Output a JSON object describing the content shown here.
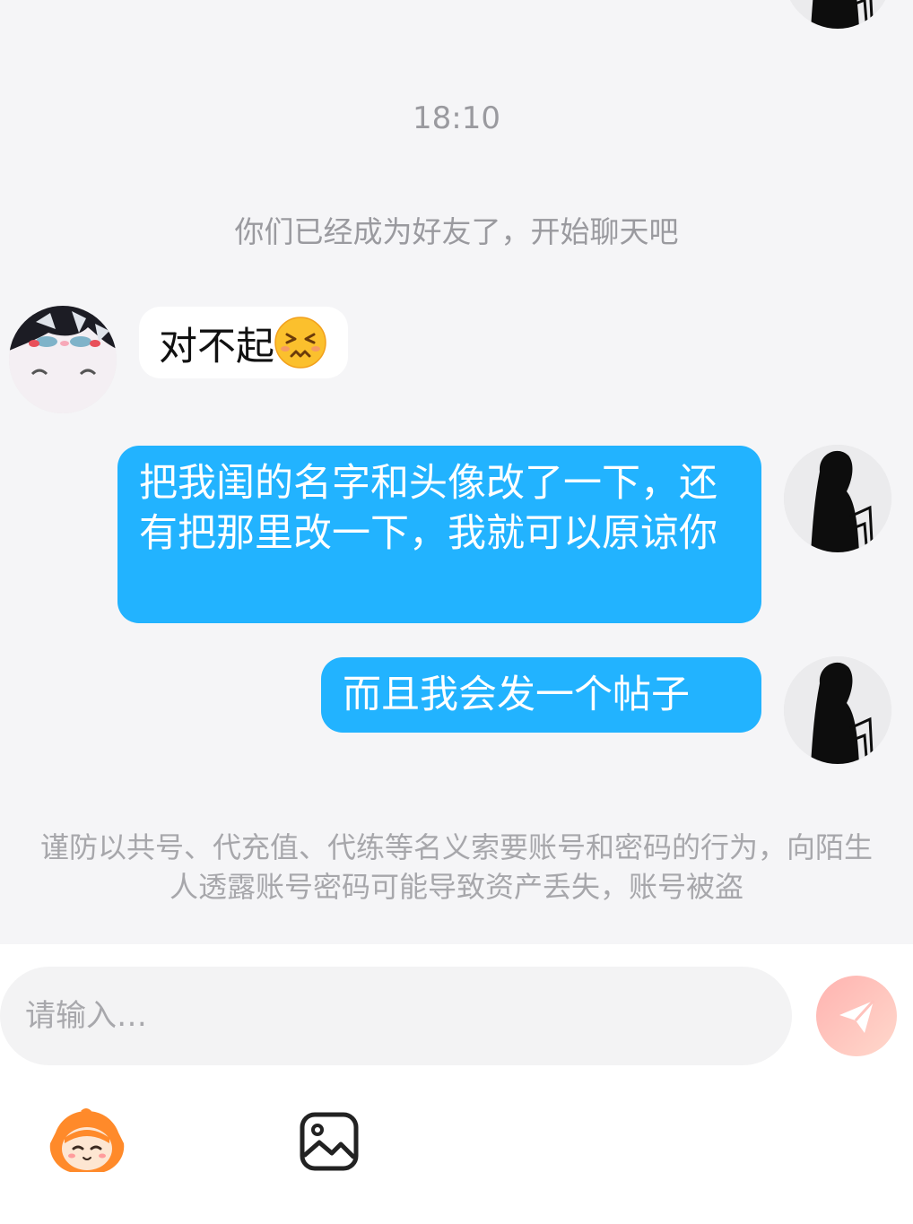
{
  "chat": {
    "timestamp": "18:10",
    "system_notice": "你们已经成为好友了，开始聊天吧",
    "messages": [
      {
        "side": "received",
        "text": "对不起",
        "emoji": "persevering-face"
      },
      {
        "side": "sent",
        "text": "把我闺的名字和头像改了一下，还有把那里改一下，我就可以原谅你"
      },
      {
        "side": "sent",
        "text": "而且我会发一个帖子"
      }
    ],
    "warning": "谨防以共号、代充值、代练等名义索要账号和密码的行为，向陌生人透露账号密码可能导致资产丢失，账号被盗"
  },
  "composer": {
    "placeholder": "请输入…",
    "send_icon": "paper-plane-icon",
    "tools": [
      "mascot-emoji-icon",
      "image-picker-icon"
    ]
  },
  "colors": {
    "sent_bubble": "#22b3ff",
    "received_bubble": "#ffffff",
    "background": "#f5f5f7",
    "send_button": "#ffc2bc"
  }
}
